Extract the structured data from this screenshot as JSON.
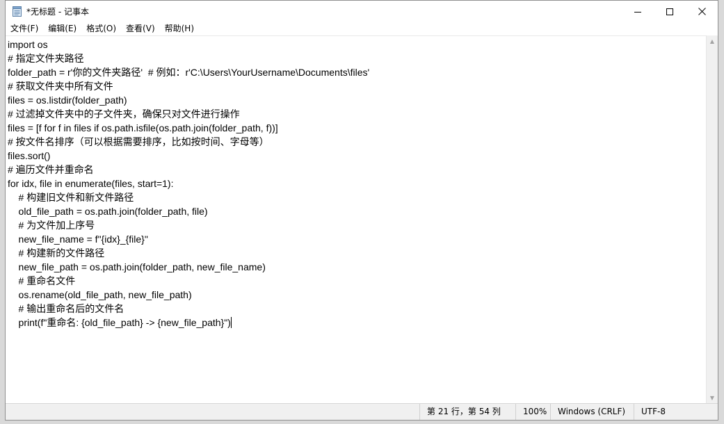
{
  "window": {
    "title": "*无标题 - 记事本",
    "controls": {
      "minimize_icon": "minimize-icon",
      "maximize_icon": "maximize-icon",
      "close_icon": "close-icon"
    }
  },
  "menu": {
    "items": [
      {
        "label": "文件(F)"
      },
      {
        "label": "编辑(E)"
      },
      {
        "label": "格式(O)"
      },
      {
        "label": "查看(V)"
      },
      {
        "label": "帮助(H)"
      }
    ]
  },
  "editor": {
    "lines": [
      "import os",
      "# 指定文件夹路径",
      "folder_path = r'你的文件夹路径'  # 例如：r'C:\\Users\\YourUsername\\Documents\\files'",
      "# 获取文件夹中所有文件",
      "files = os.listdir(folder_path)",
      "# 过滤掉文件夹中的子文件夹，确保只对文件进行操作",
      "files = [f for f in files if os.path.isfile(os.path.join(folder_path, f))]",
      "# 按文件名排序（可以根据需要排序，比如按时间、字母等）",
      "files.sort()",
      "# 遍历文件并重命名",
      "for idx, file in enumerate(files, start=1):",
      "    # 构建旧文件和新文件路径",
      "    old_file_path = os.path.join(folder_path, file)",
      "    # 为文件加上序号",
      "    new_file_name = f\"{idx}_{file}\"",
      "    # 构建新的文件路径",
      "    new_file_path = os.path.join(folder_path, new_file_name)",
      "    # 重命名文件",
      "    os.rename(old_file_path, new_file_path)",
      "    # 输出重命名后的文件名",
      "    print(f\"重命名: {old_file_path} -> {new_file_path}\")"
    ]
  },
  "statusbar": {
    "position": "第 21 行，第 54 列",
    "zoom": "100%",
    "line_ending": "Windows (CRLF)",
    "encoding": "UTF-8"
  }
}
